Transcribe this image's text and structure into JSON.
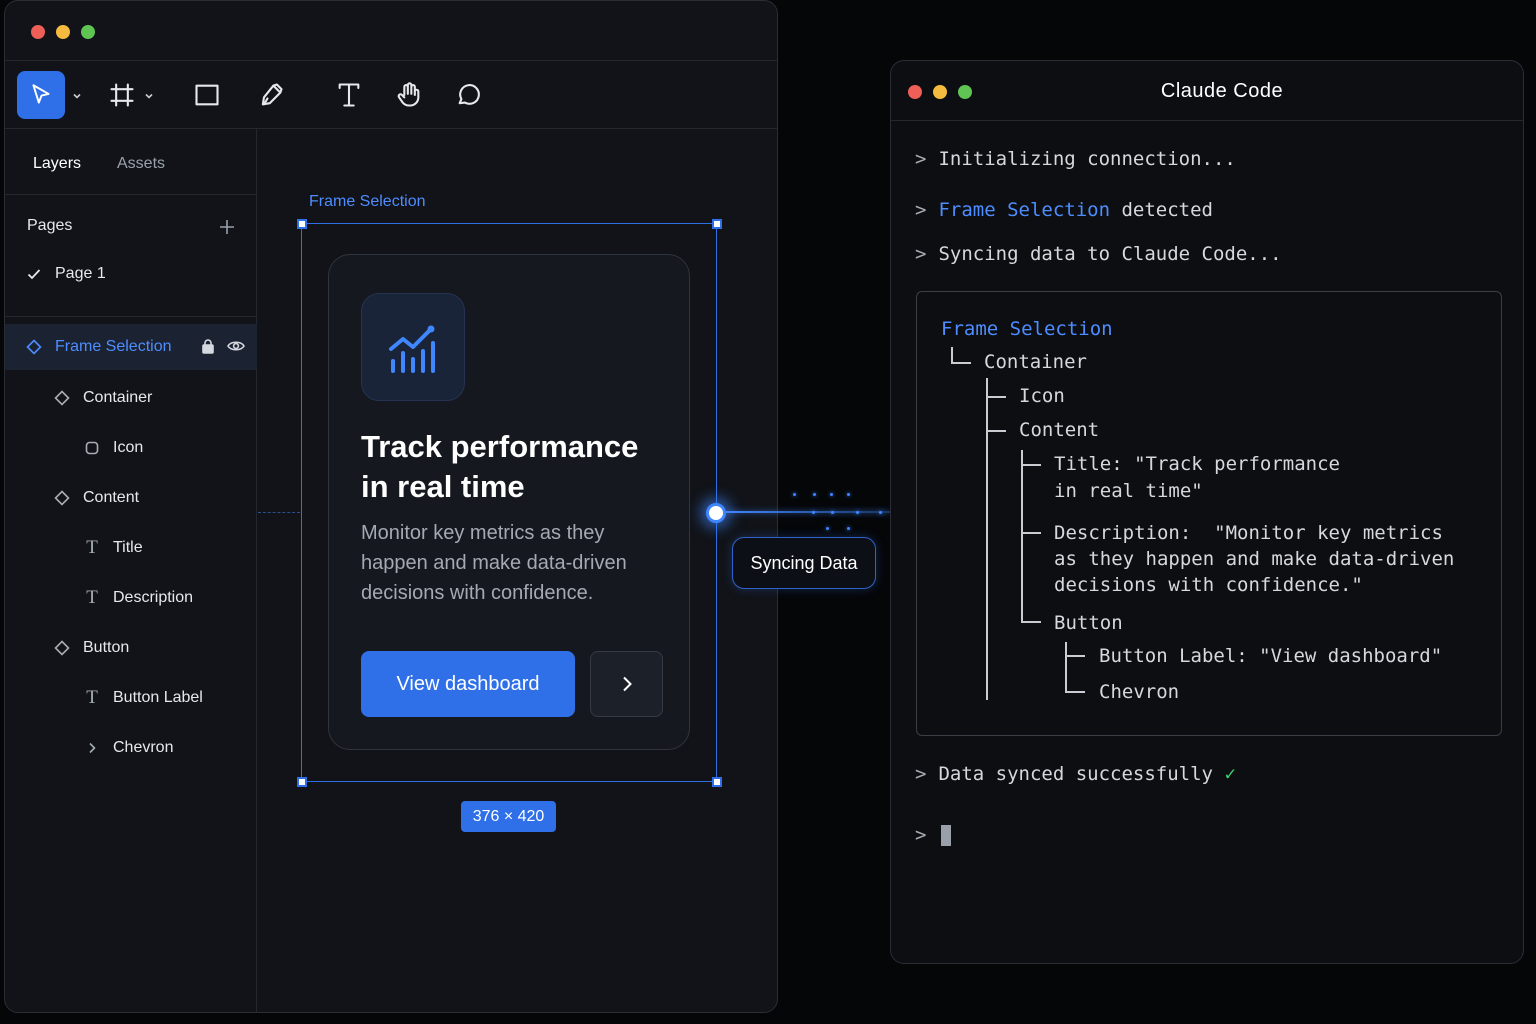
{
  "design": {
    "tabs": {
      "layers": "Layers",
      "assets": "Assets"
    },
    "pages": {
      "title": "Pages",
      "items": [
        "Page 1"
      ]
    },
    "layers": [
      {
        "label": "Frame Selection"
      },
      {
        "label": "Container"
      },
      {
        "label": "Icon"
      },
      {
        "label": "Content"
      },
      {
        "label": "Title"
      },
      {
        "label": "Description"
      },
      {
        "label": "Button"
      },
      {
        "label": "Button Label"
      },
      {
        "label": "Chevron"
      }
    ],
    "canvas": {
      "frame_label": "Frame Selection",
      "card_title": "Track performance in real time",
      "card_description": "Monitor key metrics as they happen and make data-driven decisions with confidence.",
      "primary_button": "View dashboard",
      "size_badge": "376 × 420",
      "sync_status": "Syncing Data"
    }
  },
  "terminal": {
    "title": "Claude Code",
    "lines": {
      "init": "Initializing connection...",
      "detected_hl": "Frame Selection",
      "detected_rest": " detected",
      "syncing": "Syncing data to Claude Code...",
      "synced": "Data synced successfully",
      "synced_check": "✓"
    },
    "tree": {
      "root": "Frame Selection",
      "container": "Container",
      "icon": "Icon",
      "content": "Content",
      "title_1": "Title: \"Track performance",
      "title_2": "in real time\"",
      "desc_1": "Description:  \"Monitor key metrics",
      "desc_2": "as they happen and make data-driven",
      "desc_3": "decisions with confidence.\"",
      "button": "Button",
      "button_label": "Button Label: \"View dashboard\"",
      "chevron": "Chevron"
    }
  },
  "colors": {
    "accent": "#2f6fe8",
    "accent_text": "#4d8dff",
    "success": "#3fd16a",
    "background": "#050608"
  }
}
